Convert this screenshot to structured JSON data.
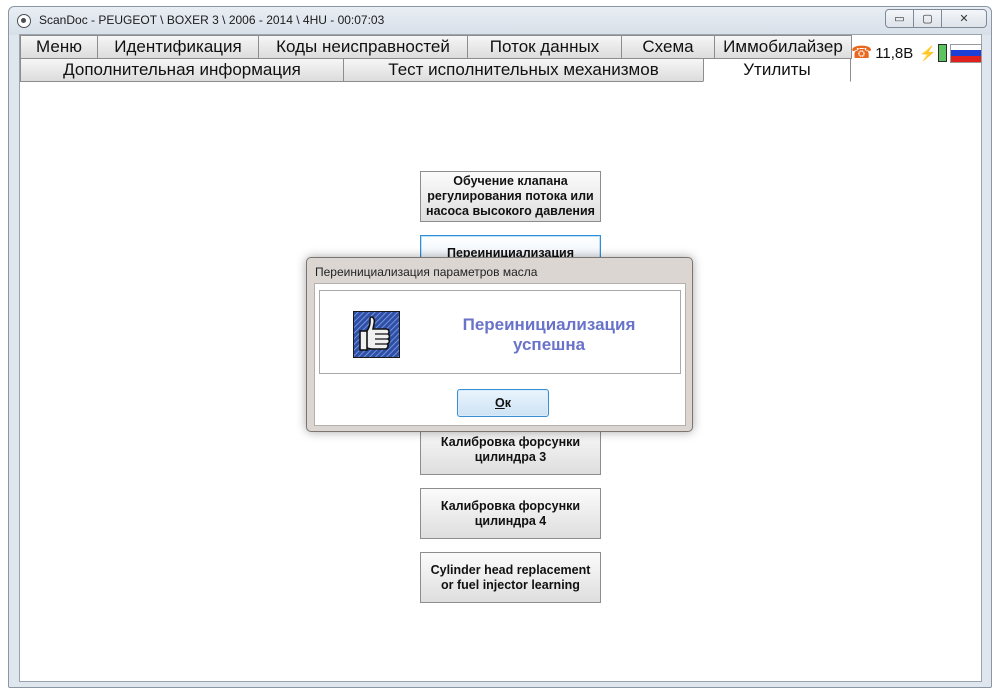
{
  "window": {
    "title": "ScanDoc - PEUGEOT \\ BOXER 3 \\ 2006 - 2014 \\ 4HU - 00:07:03",
    "controls": {
      "minimize": "▭",
      "maximize": "▢",
      "close": "✕"
    }
  },
  "tabs_row1": [
    {
      "label": "Меню"
    },
    {
      "label": "Идентификация"
    },
    {
      "label": "Коды неисправностей"
    },
    {
      "label": "Поток данных"
    },
    {
      "label": "Схема"
    },
    {
      "label": "Иммобилайзер"
    }
  ],
  "tabs_row2": [
    {
      "label": "Дополнительная информация"
    },
    {
      "label": "Тест исполнительных механизмов"
    },
    {
      "label": "Утилиты",
      "active": true
    }
  ],
  "status": {
    "voltage": "11,8В",
    "phone_icon": "☎",
    "plug_icon": "⚡",
    "flag_colors": [
      "#ffffff",
      "#1c3fd6",
      "#e0201c"
    ]
  },
  "utility_buttons": [
    {
      "label": "Обучение клапана регулирования потока или насоса высокого давления"
    },
    {
      "label": "Переинициализация"
    },
    {
      "label": "Калибровка форсунки цилиндра 3"
    },
    {
      "label": "Калибровка форсунки цилиндра 4"
    },
    {
      "label": "Cylinder head replacement or fuel injector learning"
    }
  ],
  "dialog": {
    "title": "Переинициализация параметров масла",
    "message": "Переинициализация успешна",
    "ok_prefix": "О",
    "ok_rest": "к",
    "message_color": "#6973c9"
  }
}
